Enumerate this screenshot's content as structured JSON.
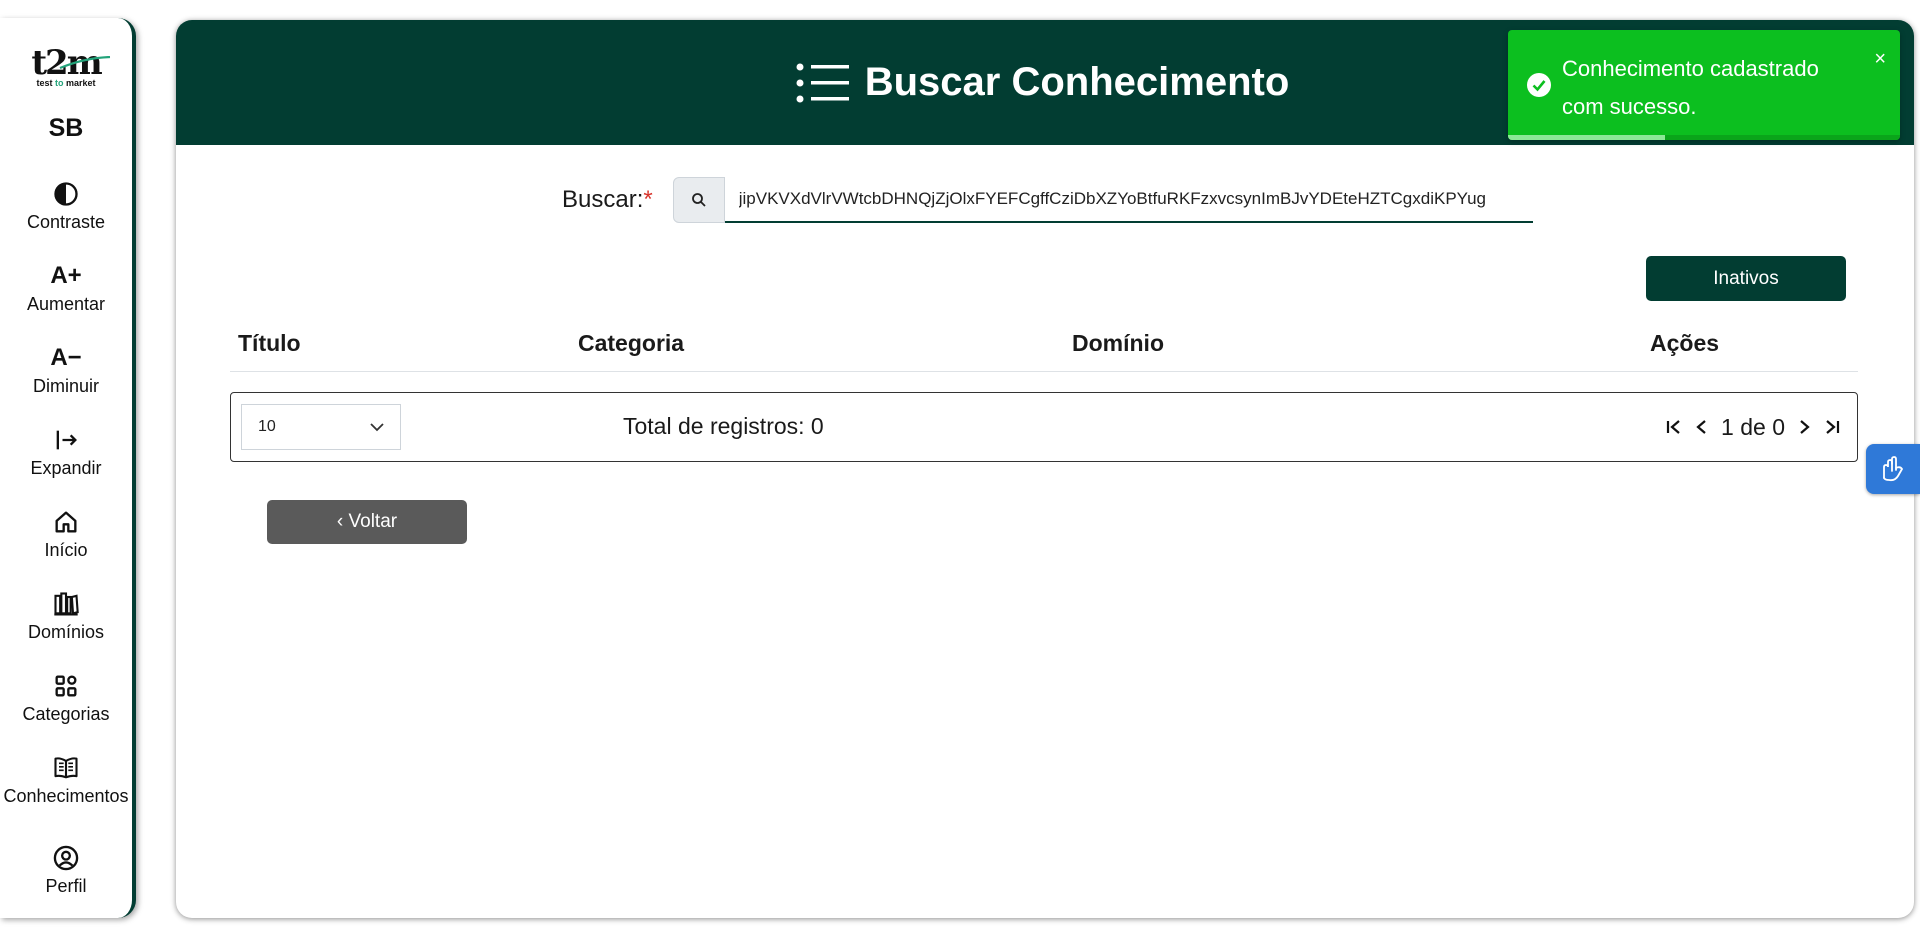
{
  "sidebar": {
    "logo_text": "t2m",
    "logo_sub_test": "test",
    "logo_sub_to": "to",
    "logo_sub_market": "market",
    "initials": "SB",
    "items": [
      {
        "label": "Contraste",
        "icon": "contrast-icon"
      },
      {
        "label": "Aumentar",
        "icon_text": "A+"
      },
      {
        "label": "Diminuir",
        "icon_text": "A−"
      },
      {
        "label": "Expandir",
        "icon": "expand-icon"
      },
      {
        "label": "Início",
        "icon": "home-icon"
      },
      {
        "label": "Domínios",
        "icon": "books-icon"
      },
      {
        "label": "Categorias",
        "icon": "grid-icon"
      },
      {
        "label": "Conhecimentos",
        "icon": "book-open-icon"
      },
      {
        "label": "Perfil",
        "icon": "user-circle-icon"
      }
    ]
  },
  "header": {
    "title": "Buscar Conhecimento",
    "icon": "list-icon"
  },
  "search": {
    "label": "Buscar:",
    "required_mark": "*",
    "value": "jipVKVXdVlrVWtcbDHNQjZjOlxFYEFCgffCziDbXZYoBtfuRKFzxvcsynImBJvYDEteHZTCgxdiKPYug"
  },
  "buttons": {
    "inactive": "Inativos",
    "back": "‹ Voltar"
  },
  "table": {
    "columns": [
      "Título",
      "Categoria",
      "Domínio",
      "Ações"
    ],
    "rows": []
  },
  "pagination": {
    "page_size": "10",
    "total_label": "Total de registros: 0",
    "page_info": "1 de 0"
  },
  "toast": {
    "message": "Conhecimento cadastrado com sucesso.",
    "close": "×",
    "progress": 0.4,
    "color": "#0cbf1f"
  },
  "colors": {
    "primary": "#023d32",
    "back_button": "#5a5a5a",
    "accessibility_button": "#2f79d8"
  }
}
